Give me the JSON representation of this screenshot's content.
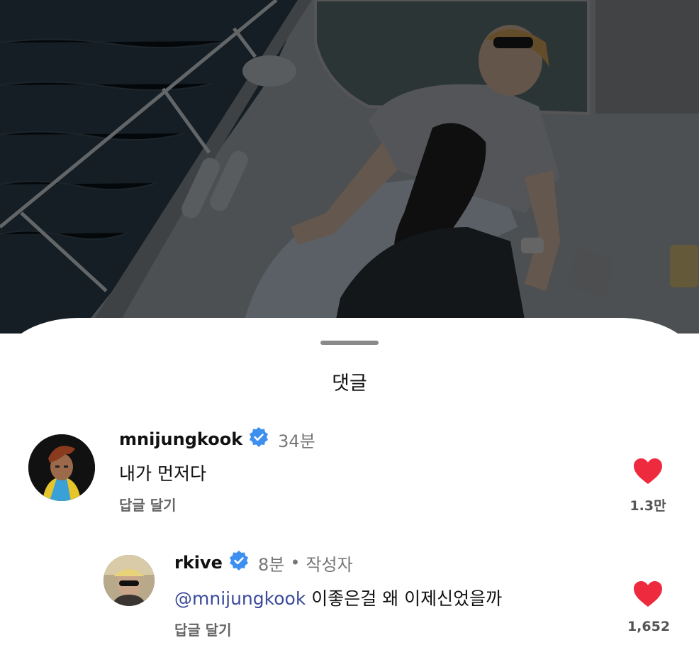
{
  "sheet": {
    "title": "댓글"
  },
  "comments": [
    {
      "username": "mnijungkook",
      "time": "34분",
      "text": "내가 먼저다",
      "reply_label": "답글 달기",
      "likes": "1.3만",
      "verified": true
    },
    {
      "username": "rkive",
      "time": "8분",
      "separator": "•",
      "author_tag": "작성자",
      "mention": "@mnijungkook",
      "text": "이좋은걸 왜 이제신었을까",
      "reply_label": "답글 달기",
      "likes": "1,652",
      "verified": true
    }
  ],
  "colors": {
    "heart": "#ee2a3f",
    "verified": "#3d8ff0",
    "mention": "#3a4a9a"
  }
}
